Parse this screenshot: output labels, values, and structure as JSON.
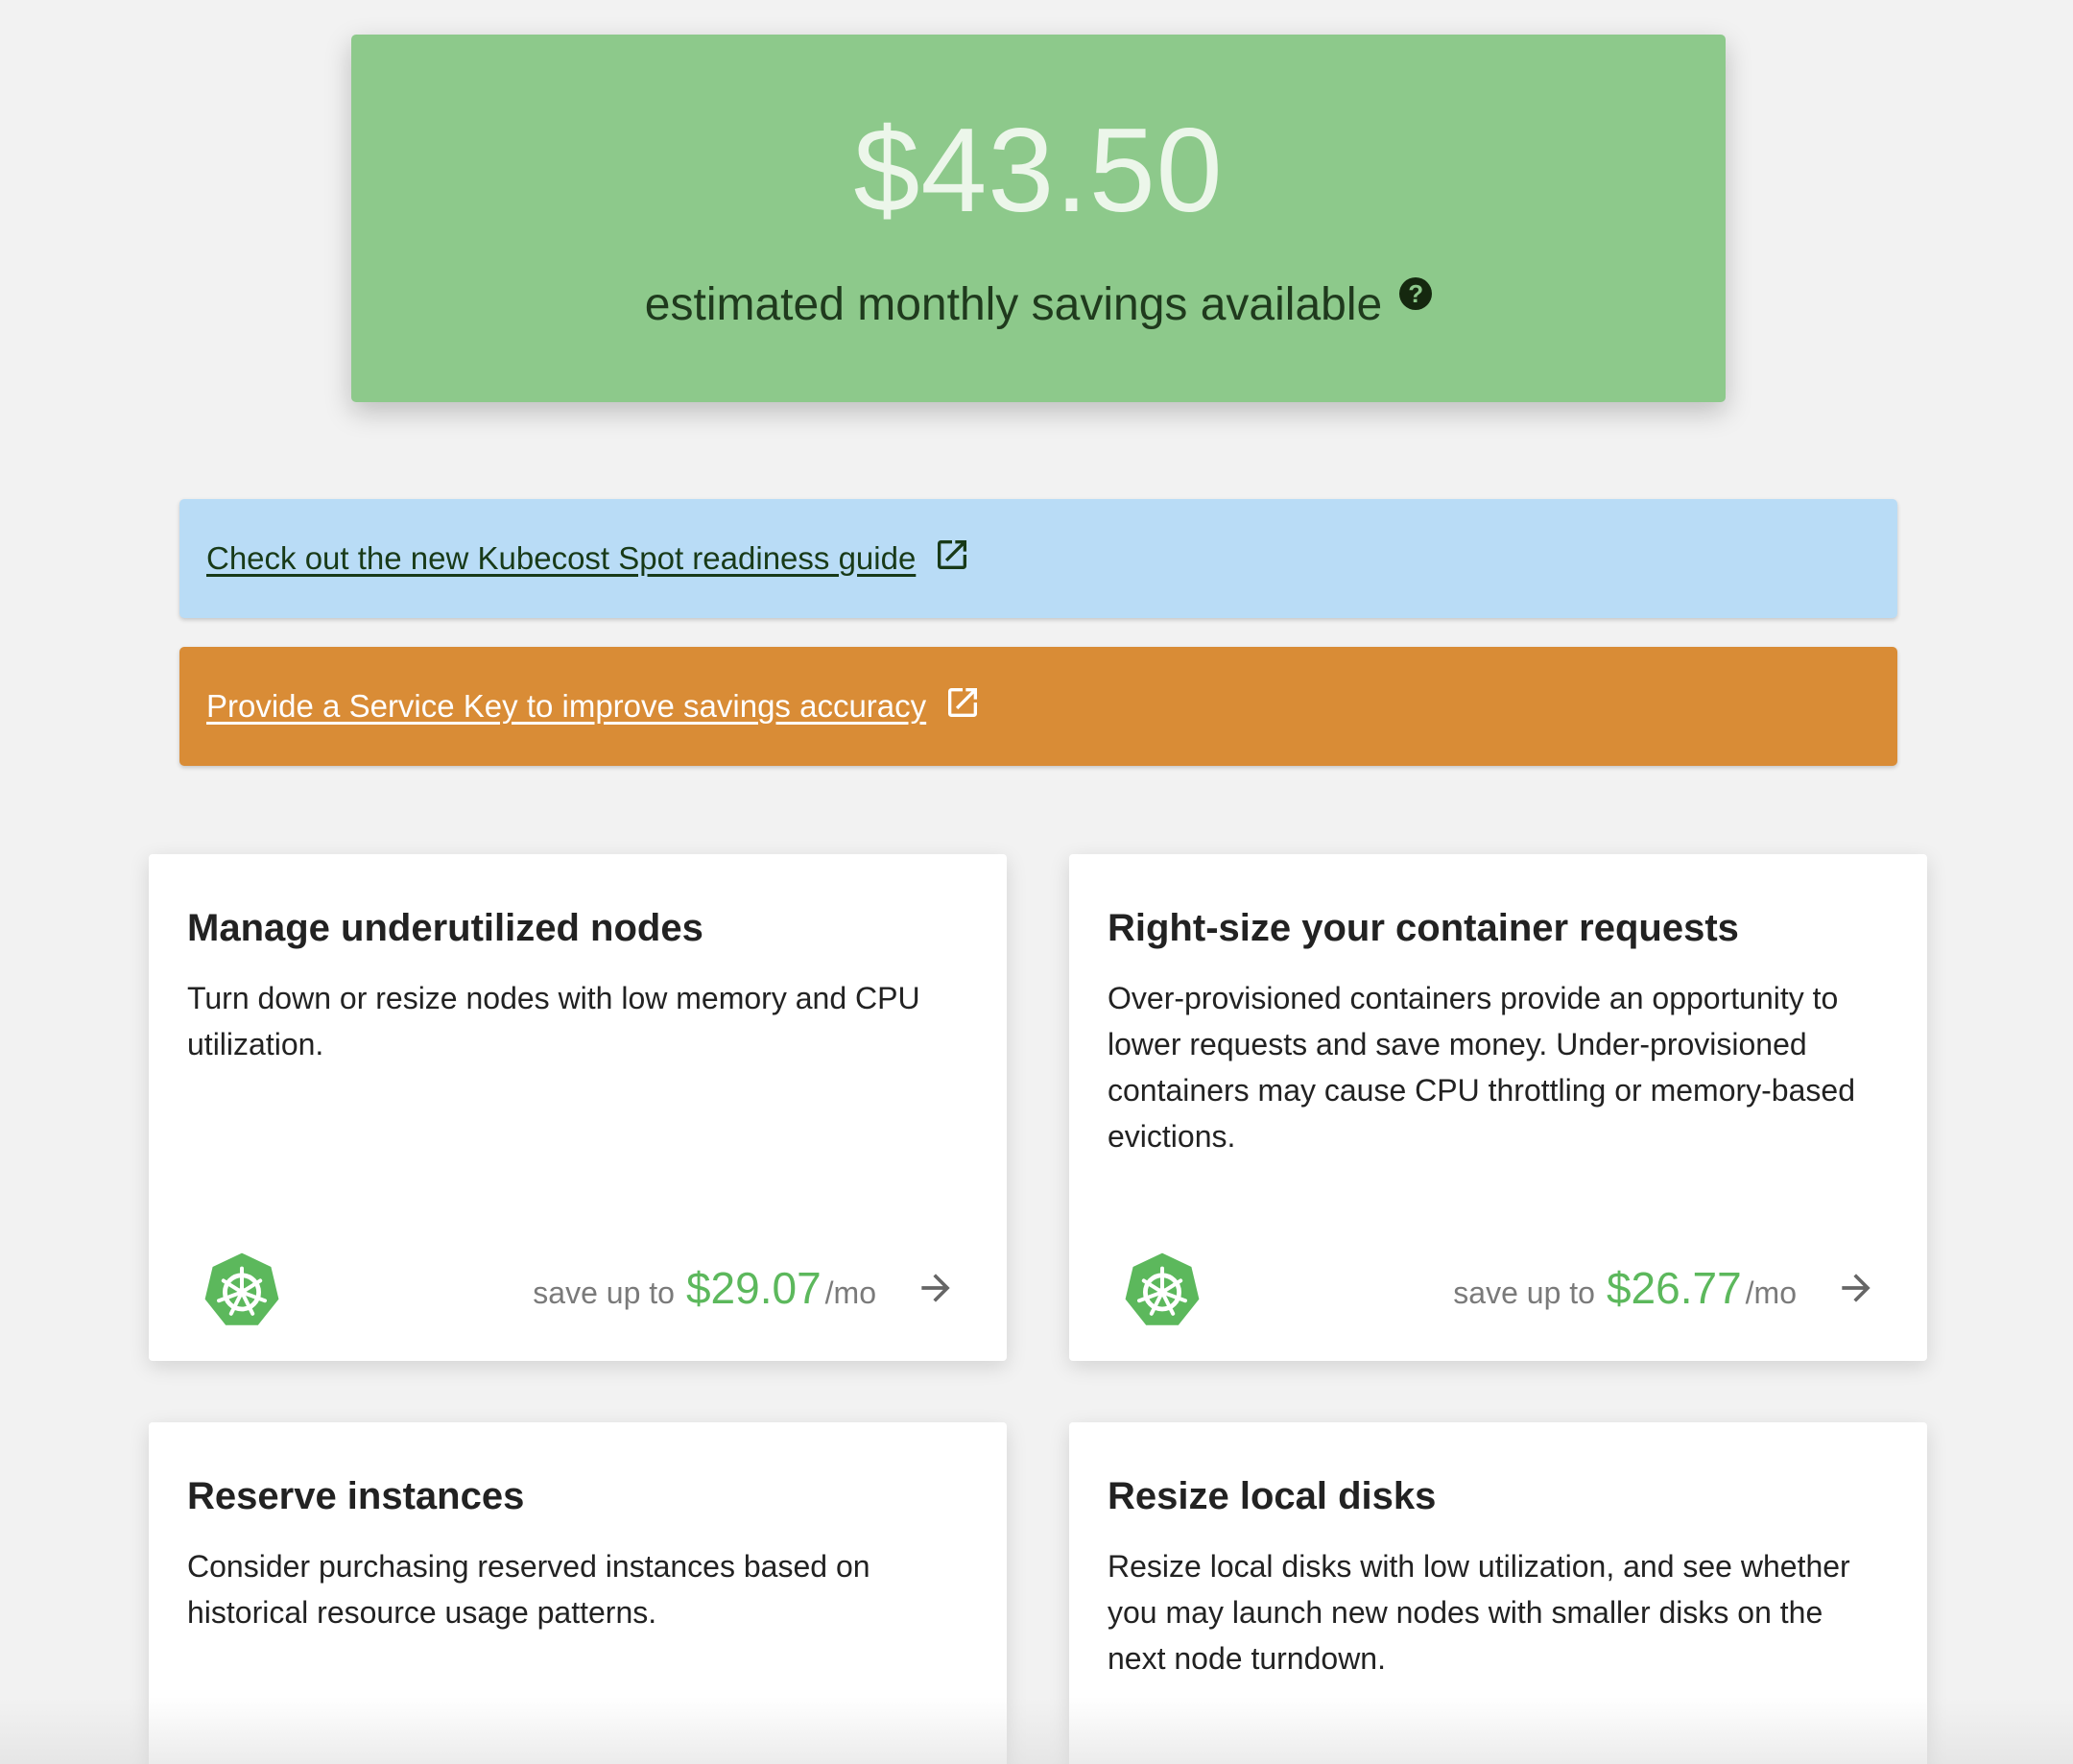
{
  "hero": {
    "amount": "$43.50",
    "caption": "estimated monthly savings available",
    "help_icon": "question-circle-icon",
    "color": "#8dc98b"
  },
  "banners": [
    {
      "text": "Check out the new Kubecost Spot readiness guide",
      "icon": "external-link-icon",
      "color": "#b9dcf6"
    },
    {
      "text": "Provide a Service Key to improve savings accuracy",
      "icon": "external-link-icon",
      "color": "#d98c36"
    }
  ],
  "cards": [
    {
      "title": "Manage underutilized nodes",
      "description": "Turn down or resize nodes with low memory and CPU utilization.",
      "save_prefix": "save up to",
      "save_amount": "$29.07",
      "save_unit": "/mo",
      "logo": "kubernetes-icon",
      "arrow": "arrow-right-icon"
    },
    {
      "title": "Right-size your container requests",
      "description": "Over-provisioned containers provide an opportunity to lower requests and save money. Under-provisioned containers may cause CPU throttling or memory-based evictions.",
      "save_prefix": "save up to",
      "save_amount": "$26.77",
      "save_unit": "/mo",
      "logo": "kubernetes-icon",
      "arrow": "arrow-right-icon"
    },
    {
      "title": "Reserve instances",
      "description": "Consider purchasing reserved instances based on historical resource usage patterns."
    },
    {
      "title": "Resize local disks",
      "description": "Resize local disks with low utilization, and see whether you may launch new nodes with smaller disks on the next node turndown."
    }
  ],
  "colors": {
    "savings_green": "#5cb85c",
    "kubernetes_green": "#5cb85c",
    "background": "#f2f2f2"
  }
}
